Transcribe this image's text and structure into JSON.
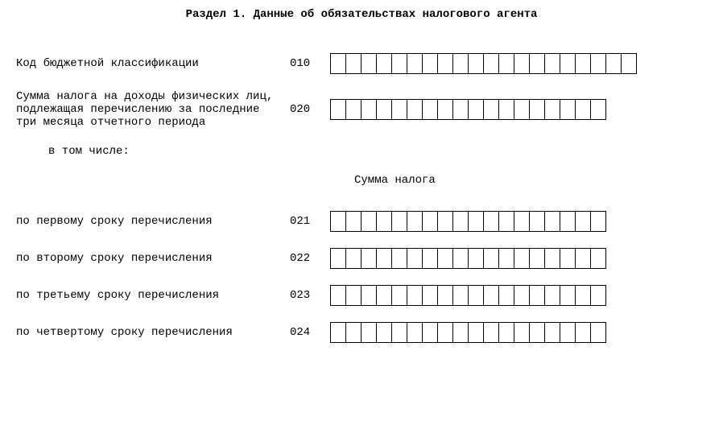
{
  "title": "Раздел 1. Данные об обязательствах налогового агента",
  "rows": {
    "r010": {
      "label": "Код бюджетной классификации",
      "code": "010",
      "cells": 20
    },
    "r020": {
      "label": "Сумма налога на доходы физических лиц, подлежащая перечислению за последние три месяца отчетного периода",
      "code": "020",
      "cells": 18
    }
  },
  "sub_label": "в том числе:",
  "column_header": "Сумма налога",
  "sub_rows": {
    "r021": {
      "label": "по первому сроку перечисления",
      "code": "021",
      "cells": 18
    },
    "r022": {
      "label": "по второму сроку перечисления",
      "code": "022",
      "cells": 18
    },
    "r023": {
      "label": "по третьему сроку перечисления",
      "code": "023",
      "cells": 18
    },
    "r024": {
      "label": "по четвертому сроку перечисления",
      "code": "024",
      "cells": 18
    }
  }
}
